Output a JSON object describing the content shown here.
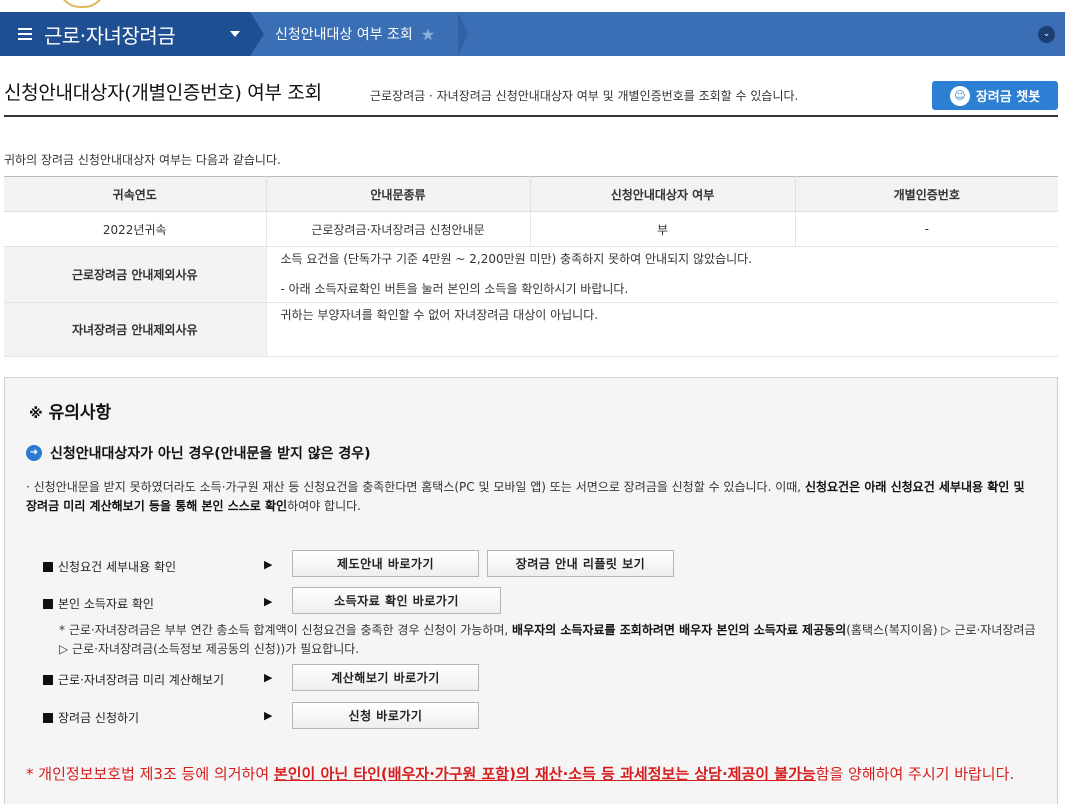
{
  "nav": {
    "title": "근로·자녀장려금",
    "breadcrumb": "신청안내대상 여부 조회"
  },
  "header": {
    "title": "신청안내대상자(개별인증번호) 여부 조회",
    "description": "근로장려금 · 자녀장려금 신청안내대상자 여부 및 개별인증번호를 조회할 수 있습니다.",
    "chatbot_label": "장려금 챗봇"
  },
  "intro": "귀하의 장려금 신청안내대상자 여부는 다음과 같습니다.",
  "table": {
    "headers": [
      "귀속연도",
      "안내문종류",
      "신청안내대상자 여부",
      "개별인증번호"
    ],
    "row": [
      "2022년귀속",
      "근로장려금·자녀장려금 신청안내문",
      "부",
      "-"
    ],
    "work_reason_label": "근로장려금 안내제외사유",
    "work_reason_lines": [
      "소득 요건을 (단독가구 기준 4만원 ~ 2,200만원 미만) 충족하지 못하여 안내되지 않았습니다.",
      "- 아래 소득자료확인 버튼을 눌러 본인의 소득을 확인하시기 바랍니다."
    ],
    "child_reason_label": "자녀장려금 안내제외사유",
    "child_reason": "귀하는 부양자녀를 확인할 수 없어 자녀장려금 대상이 아닙니다."
  },
  "notice": {
    "mark": "※",
    "title": "유의사항",
    "case_heading": "신청안내대상자가 아닌 경우(안내문을 받지 않은 경우)",
    "case_text_1": "· 신청안내문을 받지 못하였더라도 소득·가구원 재산 등 신청요건을 충족한다면 홈택스(PC 및 모바일 앱) 또는 서면으로 장려금을 신청할 수 있습니다. 이때, ",
    "case_text_bold": "신청요건은 아래 신청요건 세부내용 확인 및 장려금 미리 계산해보기 등을 통해 본인 스스로 확인",
    "case_text_2": "하여야 합니다.",
    "rows": [
      {
        "label": "신청요건 세부내용 확인",
        "buttons": [
          "제도안내 바로가기",
          "장려금 안내 리플릿 보기"
        ]
      },
      {
        "label": "본인 소득자료 확인",
        "buttons": [
          "소득자료 확인 바로가기"
        ]
      },
      {
        "label": "근로·자녀장려금 미리 계산해보기",
        "buttons": [
          "계산해보기 바로가기"
        ]
      },
      {
        "label": "장려금 신청하기",
        "buttons": [
          "신청 바로가기"
        ]
      }
    ],
    "arrow": "▶",
    "sub_note_1": "* 근로·자녀장려금은 부부 연간 총소득 합계액이 신청요건을 충족한 경우 신청이 가능하며, ",
    "sub_note_bold": "배우자의 소득자료를 조회하려면 배우자 본인의 소득자료 제공동의",
    "sub_note_2": "(홈택스(복지이음) ▷ 근로·자녀장려금 ▷ 근로·자녀장려금(소득정보 제공동의 신청))가 필요합니다.",
    "warning_1": "* 개인정보보호법 제3조 등에 의거하여 ",
    "warning_underline": "본인이 아닌 타인(배우자·가구원 포함)의 재산·소득 등 과세정보는 상담·제공이 불가능",
    "warning_2": "함을 양해하여 주시기 바랍니다."
  },
  "colors": {
    "nav_bg": "#3a6fb5",
    "nav_main_bg": "#1f4f93",
    "chatbot_bg": "#2d7fd4",
    "warning": "#d61e1e"
  }
}
